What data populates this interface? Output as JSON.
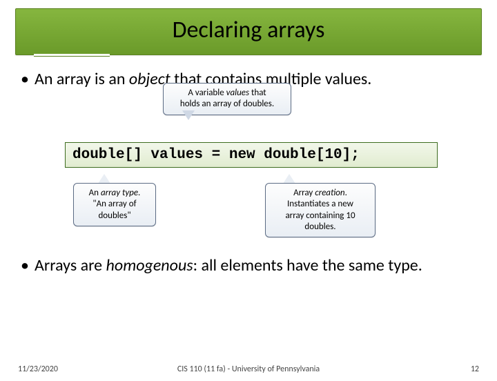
{
  "slide": {
    "title": "Declaring arrays",
    "bullet1_pre": "An array is an ",
    "bullet1_em": "object",
    "bullet1_post": " that contains multiple values.",
    "bullet2_pre": "Arrays are ",
    "bullet2_em": "homogenous",
    "bullet2_post": ": all elements have the same type."
  },
  "callouts": {
    "top": {
      "line1_pre": "A variable ",
      "line1_em": "values",
      "line1_post": " that",
      "line2": "holds an array of doubles."
    },
    "left": {
      "line1_pre": "An ",
      "line1_em": "array type",
      "line1_post": ".",
      "line2": "\"An array of",
      "line3": "doubles\""
    },
    "right": {
      "line1_pre": "Array ",
      "line1_em": "creation",
      "line1_post": ".",
      "line2": "Instantiates a new",
      "line3": "array containing 10",
      "line4": "doubles."
    }
  },
  "code": "double[] values = new double[10];",
  "footer": {
    "date": "11/23/2020",
    "center": "CIS 110 (11 fa) - University of Pennsylvania",
    "page": "12"
  }
}
